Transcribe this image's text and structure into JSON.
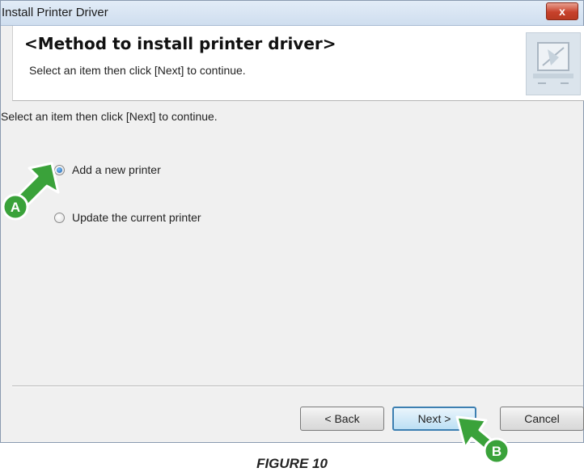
{
  "window": {
    "title": "Install Printer Driver",
    "close_label": "x"
  },
  "header": {
    "title": "<Method to install printer driver>",
    "subtitle": "Select an item then click [Next] to continue.",
    "icon": "printer-setup-icon"
  },
  "main": {
    "instruction": "Select an item then click [Next] to continue.",
    "options": [
      {
        "label": "Add a new printer",
        "checked": true
      },
      {
        "label": "Update the current printer",
        "checked": false
      }
    ]
  },
  "buttons": {
    "back": "< Back",
    "next": "Next >",
    "cancel": "Cancel"
  },
  "callouts": {
    "a": "A",
    "b": "B",
    "color": "#3aa23a"
  },
  "caption": "FIGURE 10"
}
